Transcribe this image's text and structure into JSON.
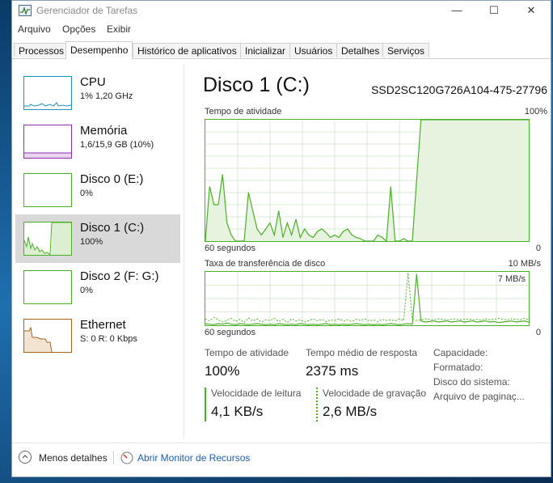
{
  "window": {
    "title": "Gerenciador de Tarefas"
  },
  "window_buttons": {
    "minimize": "—",
    "maximize": "☐",
    "close": "✕"
  },
  "menu": [
    "Arquivo",
    "Opções",
    "Exibir"
  ],
  "tabs": [
    "Processos",
    "Desempenho",
    "Histórico de aplicativos",
    "Inicializar",
    "Usuários",
    "Detalhes",
    "Serviços"
  ],
  "active_tab": "Desempenho",
  "sidebar": {
    "items": [
      {
        "title": "CPU",
        "sub": "1% 1,20 GHz",
        "color": "#1e8fc6"
      },
      {
        "title": "Memória",
        "sub": "1,6/15,9 GB (10%)",
        "color": "#8b2fa8"
      },
      {
        "title": "Disco 0 (E:)",
        "sub": "0%",
        "color": "#4caf28"
      },
      {
        "title": "Disco 1 (C:)",
        "sub": "100%",
        "color": "#4caf28"
      },
      {
        "title": "Disco 2 (F: G:)",
        "sub": "0%",
        "color": "#4caf28"
      },
      {
        "title": "Ethernet",
        "sub": "S: 0 R: 0 Kbps",
        "color": "#a7641c"
      }
    ]
  },
  "main": {
    "title": "Disco 1 (C:)",
    "model": "SSD2SC120G726A104-475-27796",
    "activity_graph": {
      "label": "Tempo de atividade",
      "max_label": "100%",
      "x_left": "60 segundos",
      "x_right": "0",
      "values": [
        0,
        45,
        30,
        30,
        55,
        15,
        5,
        0,
        0,
        0,
        40,
        25,
        10,
        5,
        10,
        15,
        5,
        25,
        3,
        15,
        5,
        18,
        3,
        10,
        5,
        3,
        8,
        10,
        7,
        3,
        5,
        3,
        8,
        10,
        5,
        3,
        2,
        0,
        0,
        0,
        5,
        3,
        0,
        45,
        0,
        0,
        2,
        0,
        0,
        50,
        100,
        100,
        100,
        100,
        100,
        100,
        100,
        100,
        100,
        100,
        100,
        100,
        100,
        100,
        100,
        100,
        100,
        100,
        100,
        100,
        100,
        100,
        100,
        100,
        100,
        100
      ]
    },
    "transfer_graph": {
      "label": "Taxa de transferência de disco",
      "max_label": "10 MB/s",
      "inner_label": "7 MB/s",
      "x_left": "60 segundos",
      "x_right": "0",
      "read_values": [
        0.3,
        0.2,
        0.1,
        0.3,
        0.2,
        0.4,
        0.2,
        0.1,
        0.3,
        0.2,
        0.1,
        0.2,
        0.3,
        0.2,
        0.1,
        0.2,
        0.1,
        0.3,
        0.2,
        0.1,
        0.2,
        0.1,
        0.3,
        0.2,
        0.1,
        0.2,
        0.1,
        0.2,
        0.3,
        0.1,
        0.2,
        0.1,
        0.2,
        0.1,
        0.2,
        0.3,
        0.2,
        0.1,
        0.2,
        0.1,
        0.2,
        0.1,
        0.2,
        0.3,
        0.2,
        0.1,
        0.2,
        0.3,
        0.2,
        9.6,
        0.8,
        0.6,
        0.7,
        0.8,
        0.6,
        0.7,
        0.8,
        0.6,
        0.7,
        0.8,
        0.6,
        0.7,
        0.8,
        0.6,
        0.7,
        0.8,
        0.6,
        0.7,
        0.5,
        0.6,
        0.7,
        0.8,
        0.6,
        0.7,
        0.8,
        0.6
      ],
      "write_values": [
        1.2,
        0.8,
        1.5,
        1.0,
        0.6,
        0.9,
        1.3,
        0.7,
        1.1,
        0.5,
        1.4,
        0.8,
        1.2,
        0.6,
        1.0,
        0.9,
        1.3,
        0.7,
        1.1,
        0.5,
        1.2,
        0.8,
        1.0,
        0.6,
        0.9,
        1.2,
        0.8,
        1.1,
        0.7,
        1.0,
        0.9,
        1.2,
        0.8,
        1.0,
        0.7,
        1.1,
        0.9,
        1.2,
        0.8,
        1.0,
        0.7,
        1.1,
        0.9,
        1.0,
        0.8,
        1.2,
        0.9,
        9.8,
        1.1,
        0.9,
        1.0,
        1.2,
        1.1,
        1.0,
        1.2,
        1.1,
        1.0,
        1.1,
        1.2,
        1.0,
        1.1,
        1.2,
        1.0,
        1.1,
        0.9,
        1.2,
        1.0,
        1.1,
        1.3,
        1.1,
        1.0,
        1.2,
        1.1,
        1.0,
        1.3,
        1.0
      ]
    },
    "stats": {
      "activity_label": "Tempo de atividade",
      "activity_value": "100%",
      "response_label": "Tempo médio de resposta",
      "response_value": "2375 ms",
      "read_label": "Velocidade de leitura",
      "read_value": "4,1 KB/s",
      "write_label": "Velocidade de gravação",
      "write_value": "2,6 MB/s",
      "capacity_label": "Capacidade:",
      "formatted_label": "Formatado:",
      "system_disk_label": "Disco do sistema:",
      "pagefile_label": "Arquivo de paginaç..."
    }
  },
  "footer": {
    "less_details": "Menos detalhes",
    "open_monitor": "Abrir Monitor de Recursos"
  }
}
